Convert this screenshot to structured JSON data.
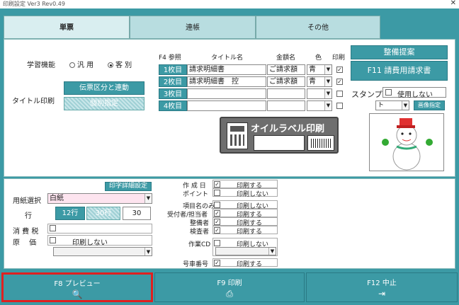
{
  "window": {
    "title": "印刷設定 Ver3 Rev0.49",
    "close": "✕"
  },
  "tabs": [
    {
      "label": "単票"
    },
    {
      "label": "連帳"
    },
    {
      "label": "その他"
    }
  ],
  "main": {
    "learning_label": "学習機能",
    "radio_general": "汎 用",
    "radio_customer": "客 別",
    "title_print_label": "タイトル印刷",
    "btn_voucher": "伝票区分と連動",
    "btn_individual": "個別指定",
    "hdr_f4": "F4 参照",
    "hdr_title": "タイトル名",
    "hdr_amount": "金額名",
    "hdr_color": "色",
    "hdr_print": "印刷",
    "rows": [
      {
        "label": "1枚目",
        "title": "請求明細書",
        "amount": "ご請求額",
        "color": "青",
        "checked": "✓"
      },
      {
        "label": "2枚目",
        "title": "請求明細書　控",
        "amount": "ご請求額",
        "color": "青",
        "checked": "✓"
      },
      {
        "label": "3枚目",
        "title": "",
        "amount": "",
        "color": "",
        "checked": ""
      },
      {
        "label": "4枚目",
        "title": "",
        "amount": "",
        "color": "",
        "checked": ""
      }
    ],
    "btn_adjust": "整備提案",
    "btn_f11": "F11 請費用請求書",
    "stamp_label": "スタンプ",
    "stamp_nouse": "使用しない",
    "stamp_value": "ト",
    "btn_stamp_specify": "画像指定",
    "oil_label": "オイルラベル印刷"
  },
  "lower": {
    "btn_detail": "印字詳細設定",
    "paper_label": "用紙選択",
    "paper_value": "白紙",
    "row_label": "行",
    "row_12": "12行",
    "row_30": "30行",
    "row_value": "30",
    "tax_label": "消 費 税",
    "cost_label": "原　 価",
    "cost_noprint": "印刷しない",
    "items": [
      {
        "label": "作 成 日",
        "checked": "✓",
        "text": "印刷する"
      },
      {
        "label": "ポイント",
        "checked": "",
        "text": "印刷しない"
      },
      {
        "label": "項目名のみ",
        "checked": "",
        "text": "印刷しない"
      },
      {
        "label": "受付者/担当者",
        "checked": "✓",
        "text": "印刷する"
      },
      {
        "label": "整備者",
        "checked": "✓",
        "text": "印刷する"
      },
      {
        "label": "検査者",
        "checked": "✓",
        "text": "印刷する"
      },
      {
        "label": "作業CD",
        "checked": "",
        "text": "印刷しない"
      },
      {
        "label": "号車番号",
        "checked": "✓",
        "text": "印刷する"
      }
    ]
  },
  "footer": {
    "preview": "F8 プレビュー",
    "print": "F9 印刷",
    "cancel": "F12 中止"
  }
}
